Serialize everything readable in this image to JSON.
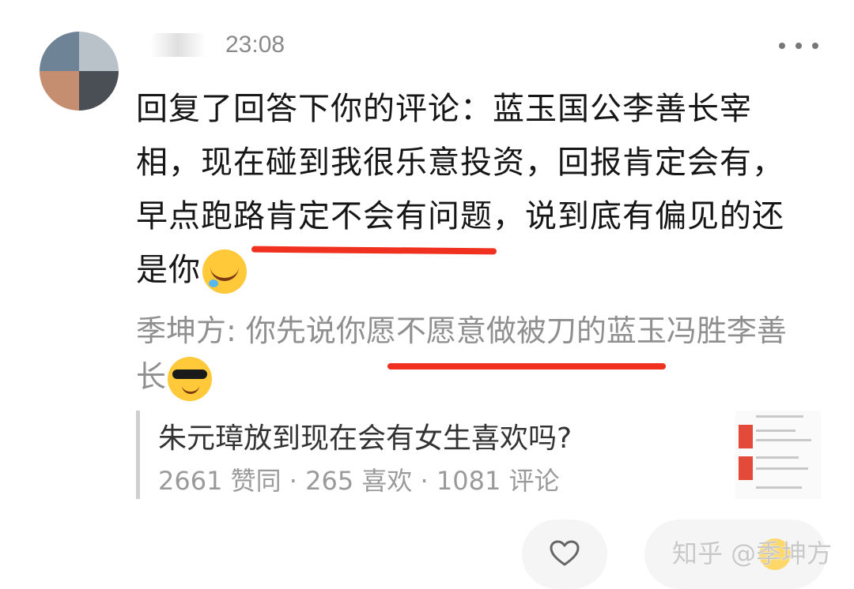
{
  "header": {
    "time": "23:08"
  },
  "reply": {
    "text": "回复了回答下你的评论：蓝玉国公李善长宰相，现在碰到我很乐意投资，回报肯定会有，早点跑路肯定不会有问题，说到底有偏见的还是你",
    "emoji": "rolling-laugh-emoji"
  },
  "parent_comment": {
    "author": "季坤方:",
    "text": "你先说你愿不愿意做被刀的蓝玉冯胜李善长",
    "emoji": "sunglasses-emoji"
  },
  "quote": {
    "title": "朱元璋放到现在会有女生喜欢吗?",
    "stats": "2661 赞同 · 265 喜欢 · 1081 评论"
  },
  "actions": {
    "like_icon": "heart-icon"
  },
  "watermark": "知乎 @季坤方",
  "colors": {
    "underline": "#f0311f",
    "muted_text": "#8f8f8f",
    "body_text": "#161616"
  }
}
